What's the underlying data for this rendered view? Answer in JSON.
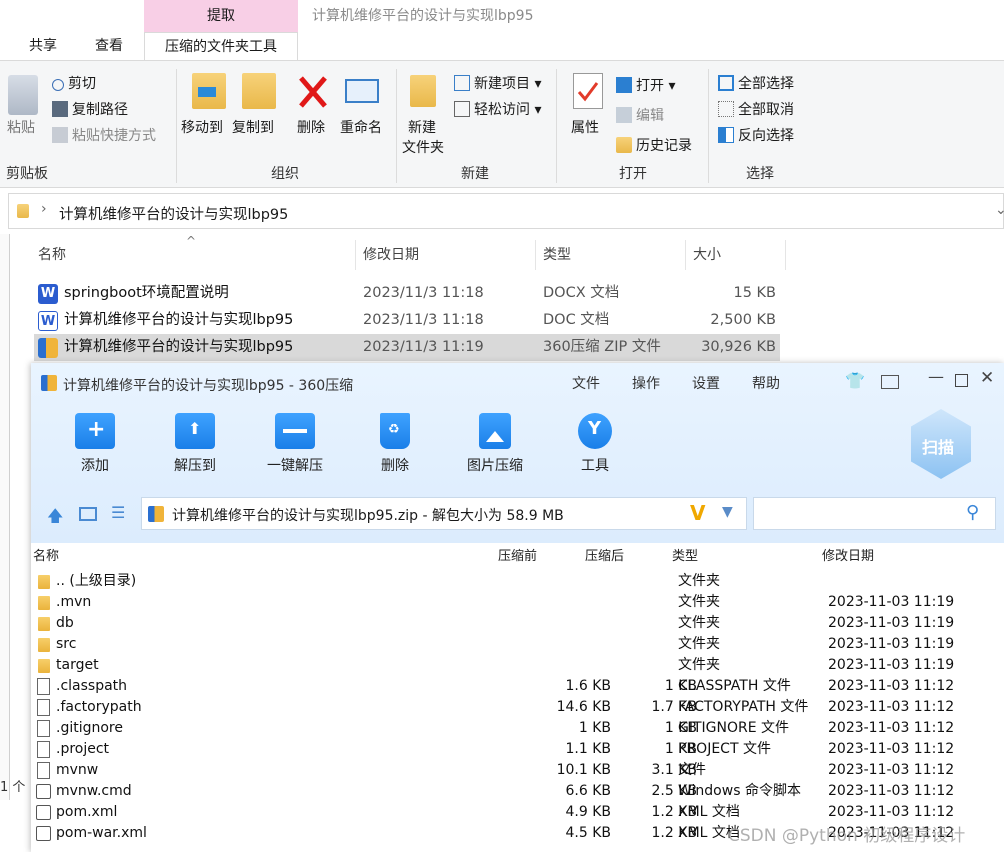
{
  "explorer": {
    "context_tab": "提取",
    "title": "计算机维修平台的设计与实现lbp95",
    "tabs": [
      "共享",
      "查看",
      "压缩的文件夹工具"
    ],
    "ribbon": {
      "clipboard": {
        "paste": "粘贴",
        "cut": "剪切",
        "copy_path": "复制路径",
        "paste_shortcut": "粘贴快捷方式",
        "group": "剪贴板"
      },
      "organize": {
        "move_to": "移动到",
        "copy_to": "复制到",
        "delete": "删除",
        "rename": "重命名",
        "group": "组织"
      },
      "new": {
        "new_folder_1": "新建",
        "new_folder_2": "文件夹",
        "new_item": "新建项目",
        "easy_access": "轻松访问",
        "group": "新建"
      },
      "open": {
        "properties": "属性",
        "open": "打开",
        "edit": "编辑",
        "history": "历史记录",
        "group": "打开"
      },
      "select": {
        "select_all": "全部选择",
        "select_none": "全部取消",
        "invert": "反向选择",
        "group": "选择"
      }
    },
    "address": "计算机维修平台的设计与实现lbp95",
    "columns": {
      "name": "名称",
      "date": "修改日期",
      "type": "类型",
      "size": "大小"
    },
    "files": [
      {
        "name": "springboot环境配置说明",
        "date": "2023/11/3 11:18",
        "type": "DOCX 文档",
        "size": "15 KB"
      },
      {
        "name": "计算机维修平台的设计与实现lbp95",
        "date": "2023/11/3 11:18",
        "type": "DOC 文档",
        "size": "2,500 KB"
      },
      {
        "name": "计算机维修平台的设计与实现lbp95",
        "date": "2023/11/3 11:19",
        "type": "360压缩 ZIP 文件",
        "size": "30,926 KB"
      }
    ],
    "status_fragment": "1 个"
  },
  "zip": {
    "title": "计算机维修平台的设计与实现lbp95 - 360压缩",
    "menu": [
      "文件",
      "操作",
      "设置",
      "帮助"
    ],
    "tools": [
      "添加",
      "解压到",
      "一键解压",
      "删除",
      "图片压缩",
      "工具"
    ],
    "scan_label": "扫描",
    "address": "计算机维修平台的设计与实现lbp95.zip - 解包大小为 58.9 MB",
    "columns": {
      "name": "名称",
      "orig": "压缩前",
      "comp": "压缩后",
      "type": "类型",
      "date": "修改日期"
    },
    "rows": [
      {
        "kind": "folder",
        "name": ".. (上级目录)",
        "orig": "",
        "comp": "",
        "type": "文件夹",
        "date": ""
      },
      {
        "kind": "folder",
        "name": ".mvn",
        "orig": "",
        "comp": "",
        "type": "文件夹",
        "date": "2023-11-03 11:19"
      },
      {
        "kind": "folder",
        "name": "db",
        "orig": "",
        "comp": "",
        "type": "文件夹",
        "date": "2023-11-03 11:19"
      },
      {
        "kind": "folder",
        "name": "src",
        "orig": "",
        "comp": "",
        "type": "文件夹",
        "date": "2023-11-03 11:19"
      },
      {
        "kind": "folder",
        "name": "target",
        "orig": "",
        "comp": "",
        "type": "文件夹",
        "date": "2023-11-03 11:19"
      },
      {
        "kind": "file",
        "name": ".classpath",
        "orig": "1.6 KB",
        "comp": "1 KB",
        "type": "CLASSPATH 文件",
        "date": "2023-11-03 11:12"
      },
      {
        "kind": "file",
        "name": ".factorypath",
        "orig": "14.6 KB",
        "comp": "1.7 KB",
        "type": "FACTORYPATH 文件",
        "date": "2023-11-03 11:12"
      },
      {
        "kind": "file",
        "name": ".gitignore",
        "orig": "1 KB",
        "comp": "1 KB",
        "type": "GITIGNORE 文件",
        "date": "2023-11-03 11:12"
      },
      {
        "kind": "file",
        "name": ".project",
        "orig": "1.1 KB",
        "comp": "1 KB",
        "type": "PROJECT 文件",
        "date": "2023-11-03 11:12"
      },
      {
        "kind": "file",
        "name": "mvnw",
        "orig": "10.1 KB",
        "comp": "3.1 KB",
        "type": "文件",
        "date": "2023-11-03 11:12"
      },
      {
        "kind": "gear",
        "name": "mvnw.cmd",
        "orig": "6.6 KB",
        "comp": "2.5 KB",
        "type": "Windows 命令脚本",
        "date": "2023-11-03 11:12"
      },
      {
        "kind": "gear",
        "name": "pom.xml",
        "orig": "4.9 KB",
        "comp": "1.2 KB",
        "type": "XML 文档",
        "date": "2023-11-03 11:12"
      },
      {
        "kind": "gear",
        "name": "pom-war.xml",
        "orig": "4.5 KB",
        "comp": "1.2 KB",
        "type": "XML 文档",
        "date": "2023-11-03 11:12"
      }
    ]
  },
  "watermark": "CSDN @Python 初级程序设计",
  "colors": {
    "context_tab": "#f8cfe6",
    "zip_accent": "#1a7fe8",
    "selection": "#d9d9d9"
  }
}
